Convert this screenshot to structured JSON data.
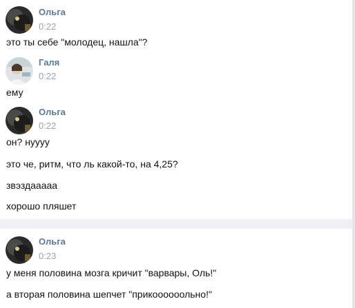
{
  "messages": [
    {
      "author": "Ольга",
      "avatar_icon": "dark-cat-avatar",
      "time": "0:22",
      "lines": [
        "это ты себе \"молодец, нашла\"?"
      ]
    },
    {
      "author": "Галя",
      "avatar_icon": "light-portrait-avatar",
      "time": "0:22",
      "lines": [
        "ему"
      ]
    },
    {
      "author": "Ольга",
      "avatar_icon": "dark-cat-avatar",
      "time": "0:22",
      "lines": [
        "он? нуууу",
        "это че, ритм, что ль какой-то, на 4,25?",
        "звэздааааа",
        "хорошо пляшет"
      ]
    },
    {
      "author": "Ольга",
      "avatar_icon": "dark-cat-avatar",
      "time": "0:23",
      "lines": [
        "у меня половина мозга кричит \"варвары, Оль!\"",
        "а вторая половина шепчет \"прикоооооольно!\""
      ]
    }
  ],
  "colors": {
    "author": "#5a7a9b",
    "time": "#9aa3ad",
    "text": "#111111",
    "divider": "#eef0f3"
  }
}
